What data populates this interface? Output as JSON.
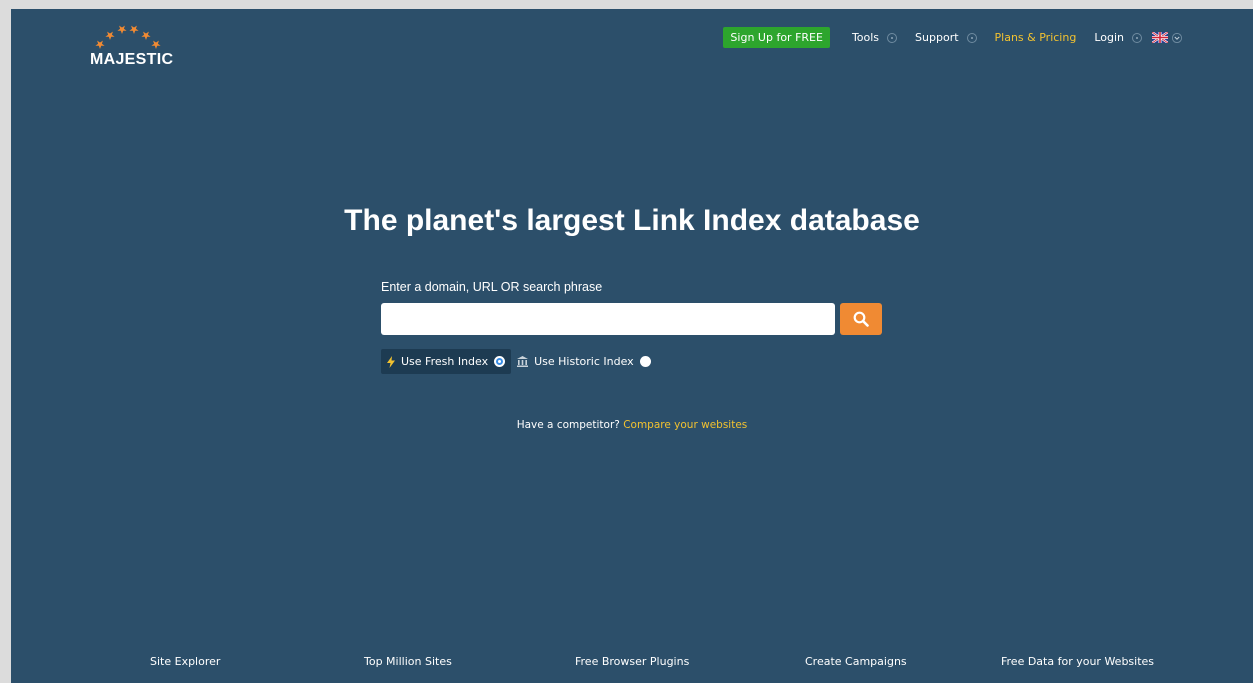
{
  "logo": {
    "text": "MAJESTIC",
    "icon": "stars-arc-logo"
  },
  "nav": {
    "signup": "Sign Up for FREE",
    "tools": "Tools",
    "support": "Support",
    "plans": "Plans & Pricing",
    "login": "Login",
    "language_icon": "uk-flag-icon"
  },
  "hero": {
    "headline": "The planet's largest Link Index database",
    "search_label": "Enter a domain, URL OR search phrase",
    "search_placeholder": "",
    "search_value": ""
  },
  "index_options": {
    "fresh": "Use Fresh Index",
    "historic": "Use Historic Index",
    "selected": "fresh"
  },
  "competitor": {
    "text": "Have a competitor?",
    "link": "Compare your websites"
  },
  "footer_links": [
    "Site Explorer",
    "Top Million Sites",
    "Free Browser Plugins",
    "Create Campaigns",
    "Free Data for your Websites"
  ],
  "colors": {
    "background": "#2c4f6a",
    "signup": "#2da52d",
    "accent_yellow": "#f2c230",
    "search_button": "#f08a33",
    "radio_selected": "#3a8ee6"
  }
}
